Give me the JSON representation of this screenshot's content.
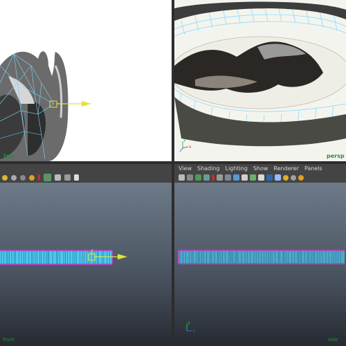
{
  "panels": {
    "top_left": {
      "camera_label": "top"
    },
    "top_right": {
      "camera_label": "persp"
    },
    "bottom_left": {
      "camera_label": "front"
    },
    "bottom_right": {
      "camera_label": "side"
    }
  },
  "panel_menu": {
    "items": [
      "View",
      "Shading",
      "Lighting",
      "Show",
      "Renderer",
      "Panels"
    ]
  },
  "axis": {
    "x": "x",
    "y": "y",
    "z": "z"
  },
  "colors": {
    "wireframe": "#7fd8ff",
    "outline": "#c04bd8",
    "manipulator": "#e2e23a",
    "viewport_gradient_top": "#6d7a88",
    "viewport_gradient_bottom": "#262a31",
    "label_green": "#1f8f3f"
  },
  "icons": [
    "select-camera-icon",
    "lock-icon",
    "bookmark-icon",
    "image-plane-icon",
    "grid-icon",
    "film-gate-icon",
    "resolution-gate-icon",
    "gate-mask-icon",
    "wireframe-icon",
    "smooth-shade-icon",
    "textured-icon",
    "lights-icon",
    "shadows-icon",
    "xray-icon",
    "isolate-icon"
  ]
}
